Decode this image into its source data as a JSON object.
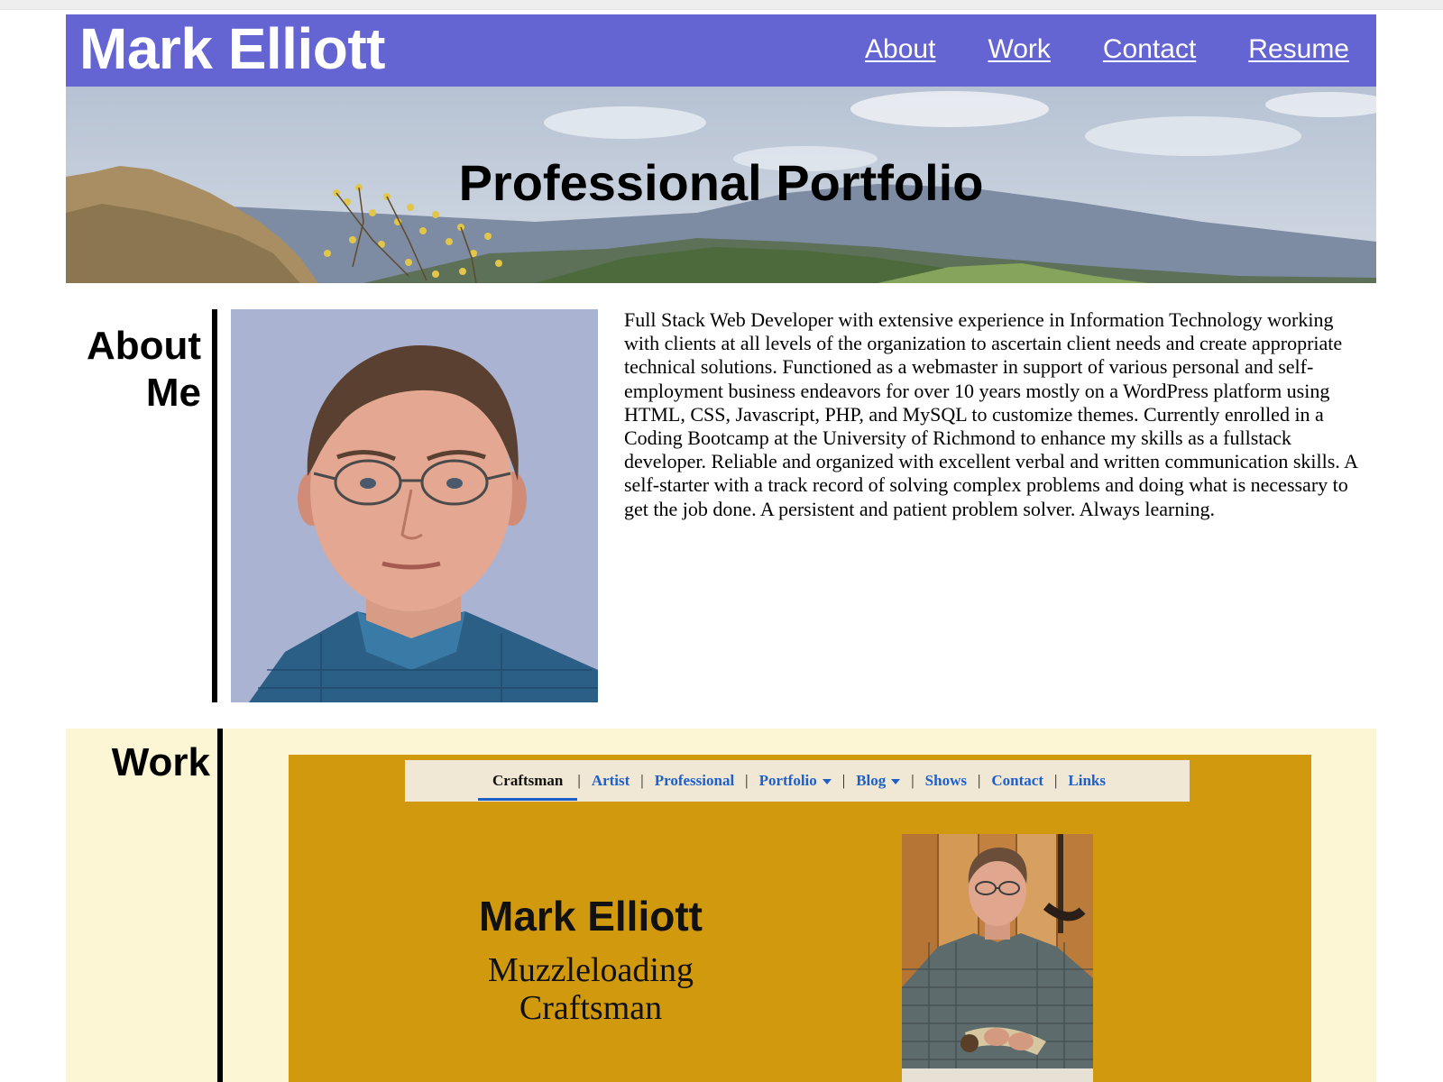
{
  "header": {
    "site_title": "Mark Elliott",
    "nav": [
      "About",
      "Work",
      "Contact",
      "Resume"
    ]
  },
  "hero": {
    "title": "Professional Portfolio"
  },
  "about": {
    "heading_line1": "About",
    "heading_line2": "Me",
    "bio": "Full Stack Web Developer with extensive experience in Information Technology working with clients at all levels of the organization to ascertain client needs and create appropriate technical solutions. Functioned as a webmaster in support of various personal and self-employment business endeavors for over 10 years mostly on a WordPress platform using HTML, CSS, Javascript, PHP, and MySQL to customize themes. Currently enrolled in a Coding Bootcamp at the University of Richmond to enhance my skills as a fullstack developer. Reliable and organized with excellent verbal and written communication skills. A self-starter with a track record of solving complex problems and doing what is necessary to get the job done. A persistent and patient problem solver. Always learning."
  },
  "work": {
    "heading": "Work",
    "project": {
      "nav": {
        "active": "Craftsman",
        "items": [
          "Artist",
          "Professional",
          "Portfolio",
          "Blog",
          "Shows",
          "Contact",
          "Links"
        ]
      },
      "name": "Mark Elliott",
      "subtitle_line1": "Muzzleloading",
      "subtitle_line2": "Craftsman"
    }
  },
  "colors": {
    "header_bg": "#6464d2",
    "work_bg": "#fdf6d4",
    "project_bg": "#d1990e",
    "project_nav_bg": "#f0e8d4",
    "project_link": "#1e5fc8"
  },
  "icons": {
    "dropdown": "chevron-down-icon"
  }
}
